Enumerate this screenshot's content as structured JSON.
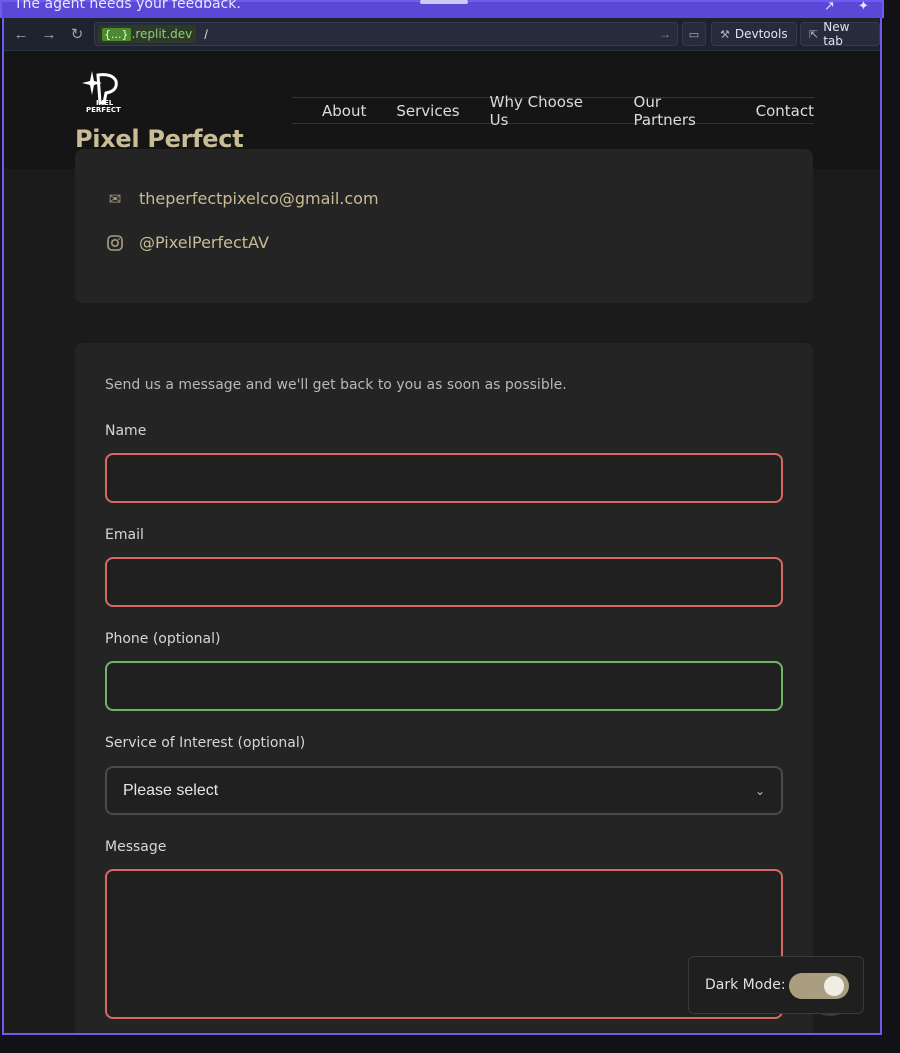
{
  "banner": {
    "notice": "The agent needs your feedback."
  },
  "browser": {
    "domain_brace": "{...}",
    "domain": ".replit.dev",
    "path": "/",
    "devtools_label": "Devtools",
    "newtab_label": "New tab"
  },
  "header": {
    "brand": "Pixel Perfect",
    "nav": [
      "About",
      "Services",
      "Why Choose Us",
      "Our Partners",
      "Contact"
    ]
  },
  "contact": {
    "email": "theperfectpixelco@gmail.com",
    "instagram": "@PixelPerfectAV"
  },
  "form": {
    "intro": "Send us a message and we'll get back to you as soon as possible.",
    "name_label": "Name",
    "name_value": "",
    "email_label": "Email",
    "email_value": "",
    "phone_label": "Phone (optional)",
    "phone_value": "",
    "service_label": "Service of Interest (optional)",
    "service_value": "Please select",
    "message_label": "Message",
    "message_value": ""
  },
  "dark_mode": {
    "label": "Dark Mode:",
    "enabled": true
  },
  "colors": {
    "accent": "#c9bd95",
    "error_border": "#d66a62",
    "valid_border": "#6fb466",
    "window_border": "#6d5cf0"
  }
}
